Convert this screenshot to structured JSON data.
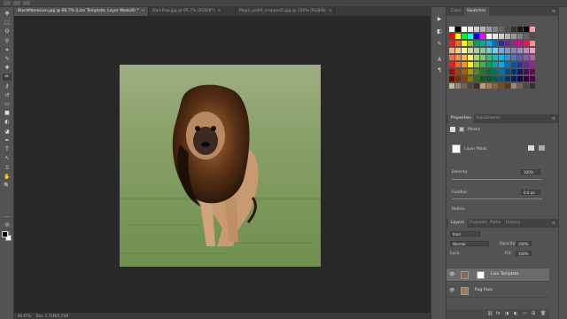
{
  "document_tabs": [
    {
      "label": "BlackManeLion.jpg @ 66.7% (Lion Template, Layer Mask/8) *",
      "close": "×",
      "active": true
    },
    {
      "label": "DarkPaw.jpg @ 66.7% (RGB/8*)",
      "close": "×",
      "active": false
    },
    {
      "label": "Maps_vol09_cropped2.jpg @ 100% (RGB/8)",
      "close": "×",
      "active": false
    }
  ],
  "status_bar": {
    "zoom": "66.67%",
    "doc_info": "Doc: 2.71M/5.71M"
  },
  "tools": [
    "move-tool",
    "marquee-tool",
    "lasso-tool",
    "quick-select-tool",
    "crop-tool",
    "eyedropper-tool",
    "spot-healing-tool",
    "brush-tool",
    "clone-stamp-tool",
    "history-brush-tool",
    "eraser-tool",
    "gradient-tool",
    "blur-tool",
    "dodge-tool",
    "pen-tool",
    "type-tool",
    "path-select-tool",
    "rectangle-tool",
    "hand-tool",
    "zoom-tool",
    "edit-toolbar",
    "quick-mask",
    "screen-mode"
  ],
  "tool_glyphs": [
    "✥",
    "⬚",
    "ʘ",
    "⚲",
    "⌗",
    "✎",
    "✚",
    "✏",
    "⚷",
    "↺",
    "▭",
    "■",
    "◐",
    "◕",
    "✒",
    "T",
    "↖",
    "▯",
    "✋",
    "🔍",
    "…",
    "◎",
    "▣"
  ],
  "icon_strip": [
    "▶",
    "◧",
    "✎",
    "A",
    "¶"
  ],
  "swatches_panel": {
    "tabs": [
      "Color",
      "Swatches"
    ],
    "active": "Swatches",
    "menu": "≡"
  },
  "swatch_colors": [
    [
      "#ffffff",
      "#000000",
      "#ffffff",
      "#e6e6e6",
      "#cccccc",
      "#b3b3b3",
      "#999999",
      "#808080",
      "#666666",
      "#4d4d4d",
      "#333333",
      "#1a1a1a",
      "#000000",
      "#ff9e9e"
    ],
    [
      "#ff0000",
      "#ffff00",
      "#00ff00",
      "#00ffff",
      "#0000ff",
      "#ff00ff",
      "#ffffff",
      "#e6e6e6",
      "#cccccc",
      "#b3b3b3",
      "#999999",
      "#808080",
      "#666666",
      "#4d4d4d"
    ],
    [
      "#ee1c25",
      "#f26522",
      "#fff200",
      "#8dc63f",
      "#00a651",
      "#00a99d",
      "#00aeef",
      "#0072bc",
      "#2e3192",
      "#662d91",
      "#92278f",
      "#ec008c",
      "#ed145b",
      "#f7977a"
    ],
    [
      "#f9ad81",
      "#fdc68a",
      "#fff79a",
      "#c4df9b",
      "#a3d39c",
      "#82ca9d",
      "#7bcdc8",
      "#6ecff6",
      "#7ea7d8",
      "#8493ca",
      "#8882be",
      "#a187be",
      "#bc8cbf",
      "#f49ac2"
    ],
    [
      "#f26c4f",
      "#f68e55",
      "#fbaf5c",
      "#fff467",
      "#acd372",
      "#7cc576",
      "#3bb878",
      "#1abbb4",
      "#00bff3",
      "#438ccb",
      "#5574b9",
      "#605ca8",
      "#855fa8",
      "#a763a8"
    ],
    [
      "#ed1c24",
      "#f26522",
      "#f7941d",
      "#fff200",
      "#8dc63f",
      "#39b54a",
      "#00a651",
      "#00a99d",
      "#00aeef",
      "#0072bc",
      "#0054a6",
      "#2e3192",
      "#662d91",
      "#92278f"
    ],
    [
      "#9e0b0f",
      "#a0410d",
      "#a36209",
      "#aba000",
      "#598527",
      "#1a7b30",
      "#007236",
      "#00746b",
      "#0076a3",
      "#004b80",
      "#003471",
      "#1b1464",
      "#440e62",
      "#630460"
    ],
    [
      "#790000",
      "#7b2e00",
      "#7d4900",
      "#827b00",
      "#406618",
      "#005e20",
      "#005826",
      "#005952",
      "#005b7f",
      "#003663",
      "#002157",
      "#0d004c",
      "#32004b",
      "#4b0049"
    ],
    [
      "#c7b299",
      "#998675",
      "#736357",
      "#534741",
      "#37302a",
      "#c69c6d",
      "#a67c52",
      "#8c6239",
      "#754c24",
      "#603913",
      "#998675",
      "#736357",
      "#534741",
      "#37302a"
    ]
  ],
  "properties_panel": {
    "tabs": [
      "Properties",
      "Adjustments"
    ],
    "active": "Properties",
    "menu": "≡",
    "section": "Masks",
    "mask_label": "Layer Mask",
    "density_label": "Density:",
    "density_value": "100%",
    "feather_label": "Feather:",
    "feather_value": "0.0 px",
    "refine_label": "Refine:"
  },
  "layers_panel": {
    "tabs": [
      "Layers",
      "Channels",
      "Paths",
      "History"
    ],
    "active": "Layers",
    "menu": "≡",
    "kind_label": "Kind",
    "blend_mode": "Normal",
    "opacity_label": "Opacity:",
    "opacity_value": "100%",
    "lock_label": "Lock:",
    "fill_label": "Fill:",
    "fill_value": "100%",
    "layers": [
      {
        "name": "Lion Template",
        "selected": true,
        "eye": "👁"
      },
      {
        "name": "Pug Face",
        "selected": false,
        "eye": "👁"
      }
    ],
    "footer_icons": [
      "⛓",
      "fx",
      "◑",
      "◐",
      "▭",
      "⊞",
      "🗑"
    ]
  }
}
